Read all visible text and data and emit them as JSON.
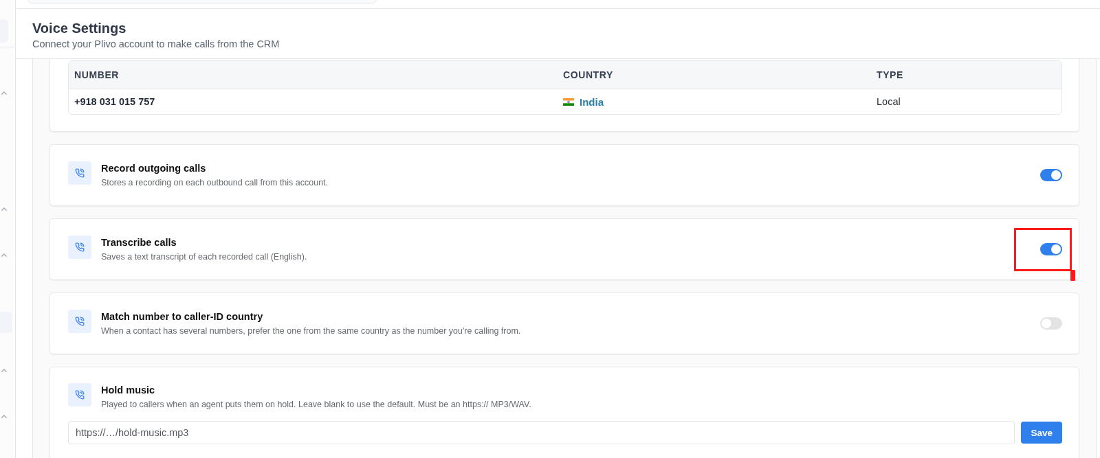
{
  "sidebar": {
    "items": [
      {
        "kind": "section",
        "expanded": true
      },
      {
        "kind": "section",
        "expanded": true
      },
      {
        "kind": "section",
        "expanded": true
      },
      {
        "kind": "item",
        "selected": true
      },
      {
        "kind": "section",
        "expanded": true
      },
      {
        "kind": "section",
        "expanded": true
      }
    ]
  },
  "header": {
    "title": "Voice Settings",
    "subtitle": "Connect your Plivo account to make calls from the CRM"
  },
  "numbers_table": {
    "columns": [
      "NUMBER",
      "COUNTRY",
      "TYPE"
    ],
    "rows": [
      {
        "number": "+918 031 015 757",
        "country": "India",
        "type": "Local"
      }
    ]
  },
  "settings": [
    {
      "kind": "toggle",
      "title": "Record outgoing calls",
      "description": "Stores a recording on each outbound call from this account.",
      "on": true,
      "highlighted": false
    },
    {
      "kind": "toggle",
      "title": "Transcribe calls",
      "description": "Saves a text transcript of each recorded call (English).",
      "on": true,
      "highlighted": true
    },
    {
      "kind": "toggle",
      "title": "Match number to caller-ID country",
      "description": "When a contact has several numbers, prefer the one from the same country as the number you're calling from.",
      "on": false,
      "highlighted": false
    },
    {
      "kind": "input",
      "title": "Hold music",
      "description": "Played to callers when an agent puts them on hold. Leave blank to use the default. Must be an https:// MP3/WAV.",
      "placeholder": "https://…/hold-music.mp3",
      "button": "Save"
    }
  ]
}
